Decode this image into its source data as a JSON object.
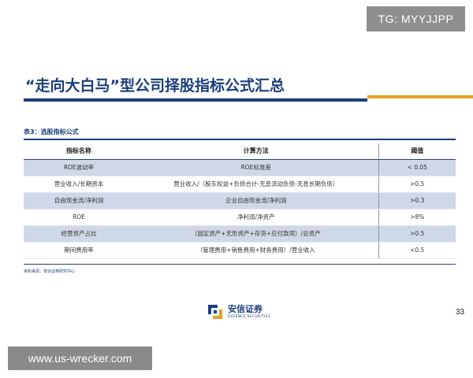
{
  "watermarks": {
    "top": "TG: MYYJJPP",
    "bottom": "www.us-wrecker.com"
  },
  "slide": {
    "title": "“走向大白马”型公司择股指标公式汇总",
    "page_number": "33",
    "accent_colors": {
      "navy": "#1d3f7d",
      "orange": "#e8a126",
      "row_shade": "#cfd8e8"
    }
  },
  "table": {
    "caption": "表3：选股指标公式",
    "headers": [
      "指标名称",
      "计算方法",
      "阈值"
    ],
    "rows": [
      [
        "ROE波动率",
        "ROE标准差",
        "< 0.05"
      ],
      [
        "营业收入/长期资本",
        "营业收入/（股东权益+负债合计-无息流动负债-无息长期负债）",
        ">0.5"
      ],
      [
        "自由现金流/净利润",
        "企业自由现金流/净利润",
        ">0.3"
      ],
      [
        "ROE",
        "净利润/净资产",
        ">8%"
      ],
      [
        "经营资产占比",
        "（固定资产+无形资产+存货+应付款项）/总资产",
        ">0.5"
      ],
      [
        "期间费用率",
        "（管理费用+销售费用+财务费用）/营业收入",
        "<0.5"
      ]
    ],
    "source": "资料来源：安信证券研究中心"
  },
  "logo": {
    "name_cn": "安信证券",
    "name_en": "ESSENCE SECURITIES",
    "icon": "essence-logo-icon"
  }
}
